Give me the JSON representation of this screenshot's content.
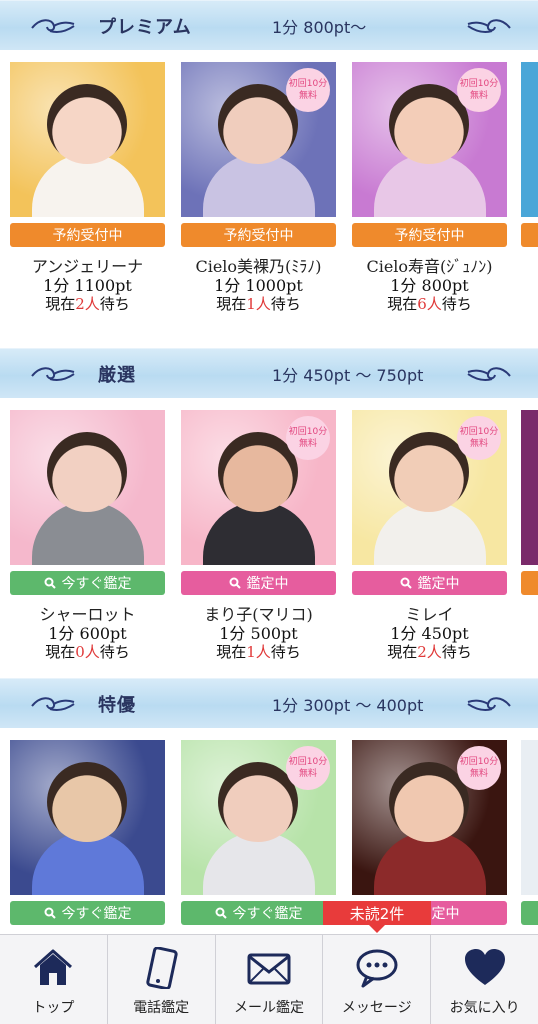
{
  "sections": [
    {
      "title": "プレミアム",
      "price_range": "1分 800pt～",
      "cards": [
        {
          "name": "アンジェリーナ",
          "status": "予約受付中",
          "status_type": "orange",
          "price": "1分 1100pt",
          "wait_prefix": "現在",
          "wait_count": "2人",
          "wait_suffix": "待ち",
          "badge": false,
          "bg": "#f3c35a",
          "skin": "#f6d6c6",
          "outfit": "#f7f3ee"
        },
        {
          "name": "Cielo美裸乃(ﾐﾗﾉ)",
          "status": "予約受付中",
          "status_type": "orange",
          "price": "1分 1000pt",
          "wait_prefix": "現在",
          "wait_count": "1人",
          "wait_suffix": "待ち",
          "badge": true,
          "bg": "#6d72b8",
          "skin": "#f0cdbd",
          "outfit": "#c9c3e3"
        },
        {
          "name": "Cielo寿音(ｼﾞｭﾉﾝ)",
          "status": "予約受付中",
          "status_type": "orange",
          "price": "1分 800pt",
          "wait_prefix": "現在",
          "wait_count": "6人",
          "wait_suffix": "待ち",
          "badge": true,
          "bg": "#c87ad2",
          "skin": "#f3cdb8",
          "outfit": "#e8c7e7"
        }
      ]
    },
    {
      "title": "厳選",
      "price_range": "1分 450pt ～ 750pt",
      "cards": [
        {
          "name": "シャーロット",
          "status": "今すぐ鑑定",
          "status_type": "green",
          "price": "1分 600pt",
          "wait_prefix": "現在",
          "wait_count": "0人",
          "wait_suffix": "待ち",
          "badge": false,
          "bg": "#f5b8cc",
          "skin": "#f2d0c2",
          "outfit": "#8a8d93"
        },
        {
          "name": "まり子(マリコ)",
          "status": "鑑定中",
          "status_type": "pink",
          "price": "1分 500pt",
          "wait_prefix": "現在",
          "wait_count": "1人",
          "wait_suffix": "待ち",
          "badge": true,
          "bg": "#f7b6c8",
          "skin": "#e7b89e",
          "outfit": "#2e2d33"
        },
        {
          "name": "ミレイ",
          "status": "鑑定中",
          "status_type": "pink",
          "price": "1分 450pt",
          "wait_prefix": "現在",
          "wait_count": "2人",
          "wait_suffix": "待ち",
          "badge": true,
          "bg": "#f7e7a2",
          "skin": "#f1cdb7",
          "outfit": "#f2f0ec"
        }
      ]
    },
    {
      "title": "特優",
      "price_range": "1分 300pt ～ 400pt",
      "cards": [
        {
          "name": "",
          "status": "今すぐ鑑定",
          "status_type": "green",
          "price": "",
          "wait_prefix": "",
          "wait_count": "",
          "wait_suffix": "",
          "badge": false,
          "bg": "#3b4a8f",
          "skin": "#e8c7a8",
          "outfit": "#5f79d9"
        },
        {
          "name": "",
          "status": "今すぐ鑑定",
          "status_type": "green",
          "price": "",
          "wait_prefix": "",
          "wait_count": "",
          "wait_suffix": "",
          "badge": true,
          "bg": "#b7e3a9",
          "skin": "#f0cdbd",
          "outfit": "#e6e6ea"
        },
        {
          "name": "",
          "status": "鑑定中",
          "status_type": "pink",
          "price": "",
          "wait_prefix": "",
          "wait_count": "",
          "wait_suffix": "",
          "badge": true,
          "bg": "#3a1510",
          "skin": "#f0c8b0",
          "outfit": "#8c2a2a"
        }
      ]
    }
  ],
  "badge": {
    "line1": "初回10分",
    "line2": "無料"
  },
  "unread_label": "未読2件",
  "tabs": [
    {
      "label": "トップ",
      "icon": "home-icon"
    },
    {
      "label": "電話鑑定",
      "icon": "phone-icon"
    },
    {
      "label": "メール鑑定",
      "icon": "mail-icon"
    },
    {
      "label": "メッセージ",
      "icon": "chat-icon"
    },
    {
      "label": "お気に入り",
      "icon": "heart-icon"
    }
  ],
  "colors": {
    "accent_orange": "#ef8a2c",
    "accent_green": "#5db86c",
    "accent_pink": "#e65d9e",
    "alert_red": "#e83b3b",
    "header_text": "#2a3560"
  }
}
